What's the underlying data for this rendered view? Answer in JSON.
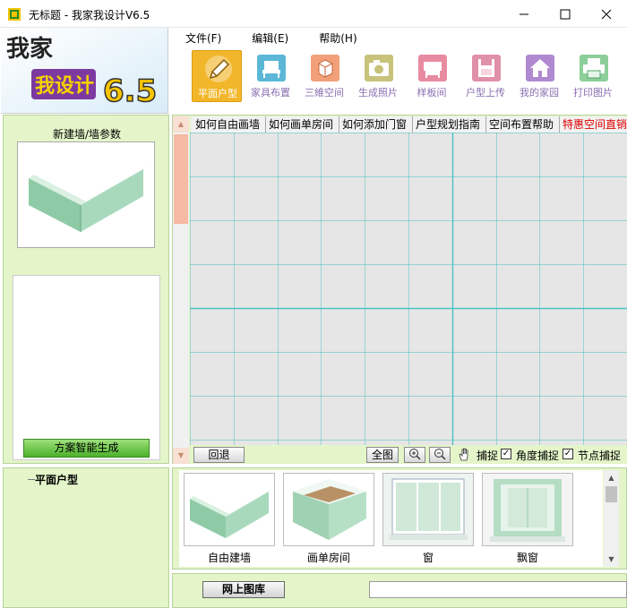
{
  "window": {
    "title": "无标题 - 我家我设计V6.5"
  },
  "logo": {
    "line1": "我家",
    "line2": "我设计",
    "version": "6.5"
  },
  "menu": [
    {
      "label": "文件(F)",
      "name": "menu-file"
    },
    {
      "label": "编辑(E)",
      "name": "menu-edit"
    },
    {
      "label": "帮助(H)",
      "name": "menu-help"
    }
  ],
  "toolbar": [
    {
      "label": "平面户型",
      "icon": "pencil-icon",
      "color": "#f2b62a",
      "active": true
    },
    {
      "label": "家具布置",
      "icon": "chair-icon",
      "color": "#5bb7d6",
      "active": false
    },
    {
      "label": "三維空间",
      "icon": "cube-icon",
      "color": "#f2a07a",
      "active": false
    },
    {
      "label": "生成照片",
      "icon": "camera-icon",
      "color": "#c8c27a",
      "active": false
    },
    {
      "label": "样板间",
      "icon": "showroom-icon",
      "color": "#e88aa0",
      "active": false
    },
    {
      "label": "户型上传",
      "icon": "floppy-icon",
      "color": "#e090a8",
      "active": false
    },
    {
      "label": "我的家园",
      "icon": "house-icon",
      "color": "#b08ad0",
      "active": false
    },
    {
      "label": "打印图片",
      "icon": "printer-icon",
      "color": "#8ccf9a",
      "active": false
    }
  ],
  "left_panel": {
    "wall_title": "新建墙/墙参数",
    "generate_button": "方案智能生成",
    "tree_root": "平面户型"
  },
  "tabs": [
    {
      "label": "如何自由画墙",
      "hot": false
    },
    {
      "label": "如何画单房间",
      "hot": false
    },
    {
      "label": "如何添加门窗",
      "hot": false
    },
    {
      "label": "户型规划指南",
      "hot": false
    },
    {
      "label": "空间布置帮助",
      "hot": false
    },
    {
      "label": "特惠空间直销",
      "hot": true
    }
  ],
  "bottom_bar": {
    "undo": "回退",
    "fit_all": "全图",
    "snap": "捕捉",
    "angle_snap": "角度捕捉",
    "node_snap": "节点捕捉",
    "angle_snap_checked": true,
    "node_snap_checked": true
  },
  "library": [
    {
      "label": "自由建墙",
      "icon": "free-wall-icon"
    },
    {
      "label": "画单房间",
      "icon": "single-room-icon"
    },
    {
      "label": "窗",
      "icon": "window-icon"
    },
    {
      "label": "飘窗",
      "icon": "bay-window-icon"
    }
  ],
  "footer": {
    "online_library": "网上图库",
    "status_value": ""
  },
  "colors": {
    "panel_bg": "#e4f5c9",
    "grid_line": "#4cc1c1",
    "canvas_bg": "#e6e6e6",
    "accent": "#f2b62a"
  }
}
